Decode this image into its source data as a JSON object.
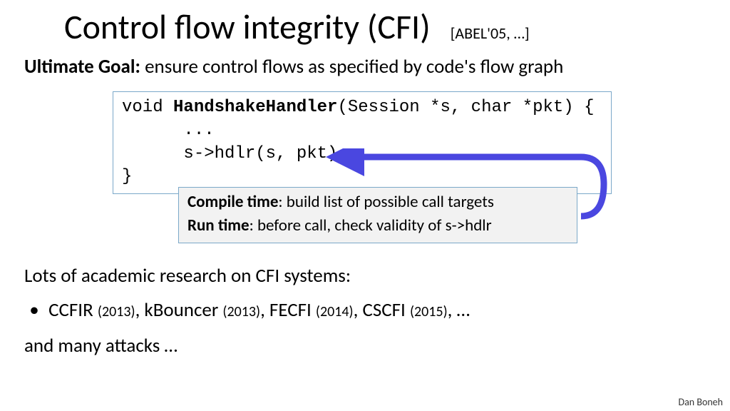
{
  "title": "Control flow integrity (CFI)",
  "citation": "[ABEL'05, …]",
  "goal_label": "Ultimate Goal:",
  "goal_text": "  ensure control flows as specified by code's flow graph",
  "code": {
    "prefix": "void ",
    "fn": "HandshakeHandler",
    "params": "(Session *s, char *pkt) {",
    "body1": "      ...",
    "body2": "      s->hdlr(s, pkt)",
    "close": "}"
  },
  "note": {
    "compile_label": "Compile time",
    "compile_text": ":  build list of possible call targets",
    "run_label": "Run time",
    "run_text": ":  before call, check validity of s->hdlr"
  },
  "research_intro": "Lots of academic research on CFI systems:",
  "systems": {
    "a_name": "CCFIR ",
    "a_year": "(2013)",
    "b_name": "  kBouncer ",
    "b_year": "(2013)",
    "c_name": "  FECFI ",
    "c_year": "(2014)",
    "d_name": "  CSCFI ",
    "d_year": "(2015)",
    "trail": ",  …"
  },
  "attacks": "and many attacks …",
  "author": "Dan Boneh",
  "arrow_color": "#4A47E0"
}
